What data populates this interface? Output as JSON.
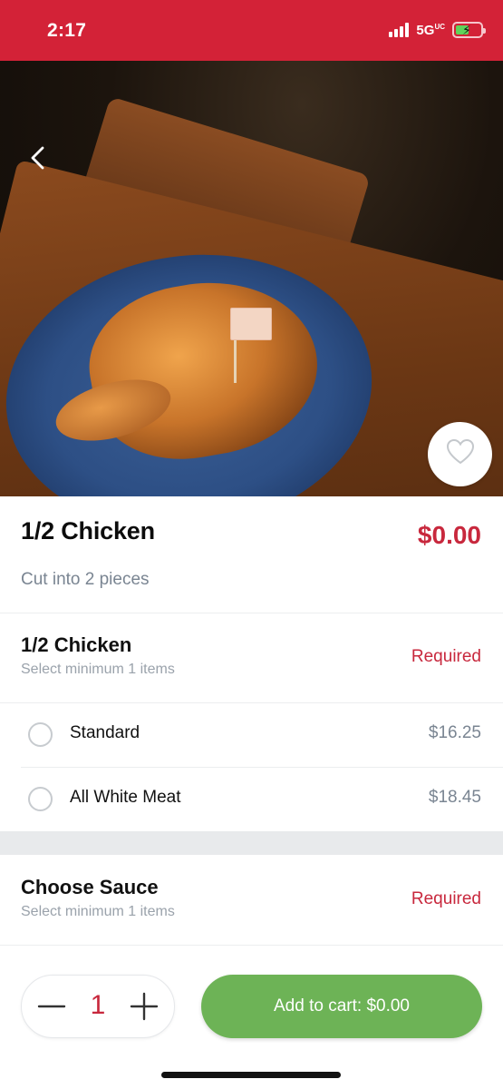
{
  "status_bar": {
    "time": "2:17",
    "network": "5G",
    "network_super": "UC",
    "battery_level": 0.55
  },
  "hero": {
    "image_alt": "Grilled half chicken on a blue plate",
    "favorite_icon": "heart-outline-icon",
    "back_icon": "chevron-left-icon"
  },
  "item": {
    "name": "1/2 Chicken",
    "price": "$0.00",
    "description": "Cut into 2 pieces"
  },
  "groups": [
    {
      "title": "1/2 Chicken",
      "subtitle": "Select minimum 1 items",
      "badge": "Required",
      "options": [
        {
          "label": "Standard",
          "price": "$16.25"
        },
        {
          "label": "All White Meat",
          "price": "$18.45"
        }
      ]
    },
    {
      "title": "Choose Sauce",
      "subtitle": "Select minimum 1 items",
      "badge": "Required",
      "options": []
    }
  ],
  "footer": {
    "quantity": "1",
    "add_label": "Add to cart: $0.00"
  },
  "colors": {
    "brand_red": "#d32237",
    "price_red": "#c8283d",
    "accent_green": "#6db356"
  }
}
